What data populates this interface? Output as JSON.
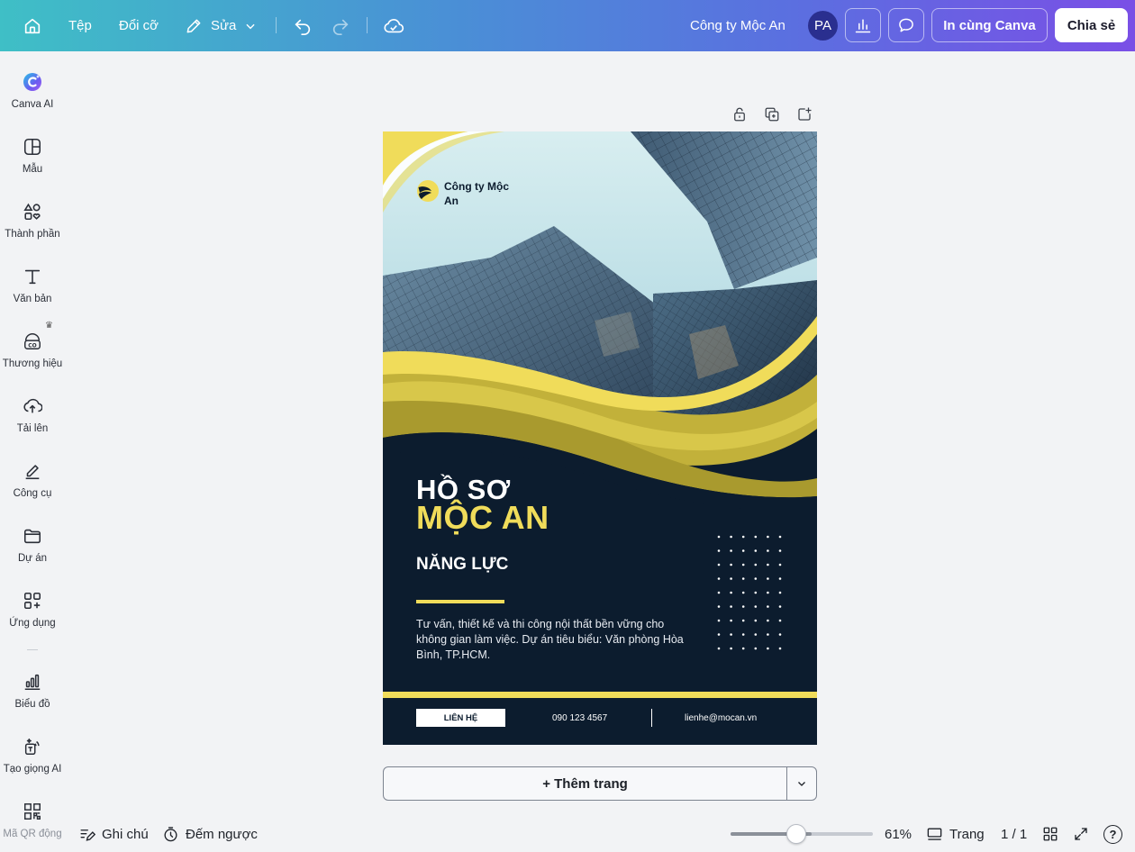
{
  "topbar": {
    "home_icon": "home-icon",
    "file_label": "Tệp",
    "resize_label": "Đổi cỡ",
    "edit_label": "Sửa",
    "company_name": "Công ty Mộc An",
    "avatar_initials": "PA",
    "print_label": "In cùng Canva",
    "share_label": "Chia sẻ"
  },
  "sidebar": {
    "items": [
      {
        "label": "Canva AI",
        "icon": "canva-ai-icon"
      },
      {
        "label": "Mẫu",
        "icon": "template-icon"
      },
      {
        "label": "Thành phần",
        "icon": "elements-icon"
      },
      {
        "label": "Văn bản",
        "icon": "text-icon"
      },
      {
        "label": "Thương hiệu",
        "icon": "brand-icon"
      },
      {
        "label": "Tải lên",
        "icon": "upload-icon"
      },
      {
        "label": "Công cụ",
        "icon": "tools-icon"
      },
      {
        "label": "Dự án",
        "icon": "folder-icon"
      },
      {
        "label": "Ứng dụng",
        "icon": "apps-icon"
      },
      {
        "label": "Biểu đồ",
        "icon": "chart-icon"
      },
      {
        "label": "Tạo giọng AI",
        "icon": "ai-voice-icon"
      },
      {
        "label": "Mã QR động",
        "icon": "qr-icon"
      }
    ]
  },
  "design": {
    "logo_text": "Công ty Mộc An",
    "title_line1": "HỒ SƠ",
    "title_line2": "MỘC AN",
    "subtitle": "NĂNG LỰC",
    "description": "Tư vấn, thiết kế và thi công nội thất bền vững cho không gian làm việc. Dự án tiêu biểu: Văn phòng Hòa Bình, TP.HCM.",
    "contact_label": "LIÊN HỆ",
    "phone": "090 123 4567",
    "email": "lienhe@mocan.vn",
    "colors": {
      "navy": "#0c1c2e",
      "yellow": "#f0dc5a",
      "olive": "#a99a2e"
    }
  },
  "add_page_label": "+ Thêm trang",
  "bottombar": {
    "notes_label": "Ghi chú",
    "timer_label": "Đếm ngược",
    "zoom_level": 61,
    "zoom_label": "61%",
    "pages_label": "Trang",
    "page_count": "1 / 1",
    "help_label": "?"
  }
}
